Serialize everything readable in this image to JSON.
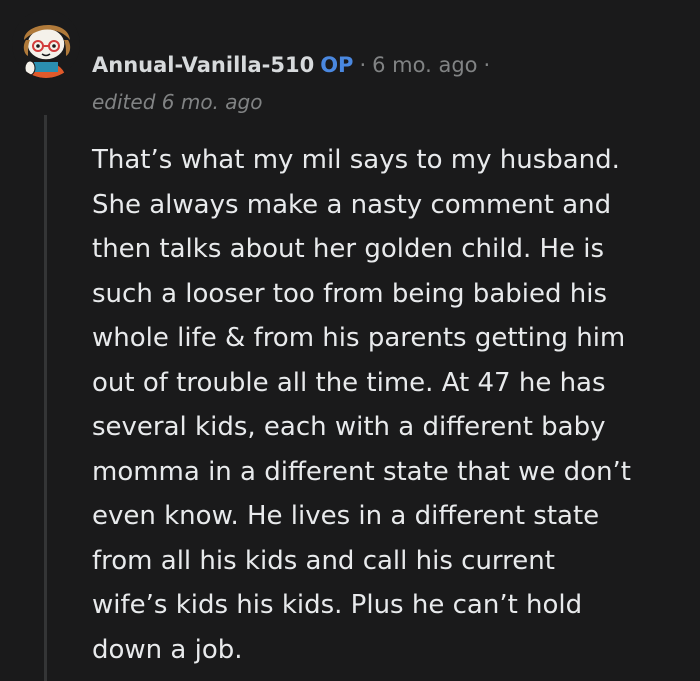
{
  "comment": {
    "author": "Annual-Vanilla-510",
    "op_badge": "OP",
    "separator": "·",
    "time_ago": "6 mo. ago",
    "edited": "edited 6 mo. ago",
    "body_lines": [
      "That’s what my mil says to my husband.",
      "She always make a nasty comment and",
      "then talks about her golden child. He is",
      "such a looser too from being babied his",
      "whole life & from his parents getting him",
      "out of trouble all the time. At 47 he has",
      "several kids, each with a different baby",
      "momma in a different state that we don’t",
      "even know. He lives in a different state",
      "from all his kids and call his current",
      "wife’s kids his kids. Plus he can’t hold",
      "down a job."
    ]
  },
  "colors": {
    "background": "#1a1a1b",
    "text": "#d7dadc",
    "op_badge": "#4a88e0",
    "muted": "#818384",
    "thread_line": "#343536"
  },
  "icons": {
    "avatar": "snoo-avatar-icon"
  }
}
